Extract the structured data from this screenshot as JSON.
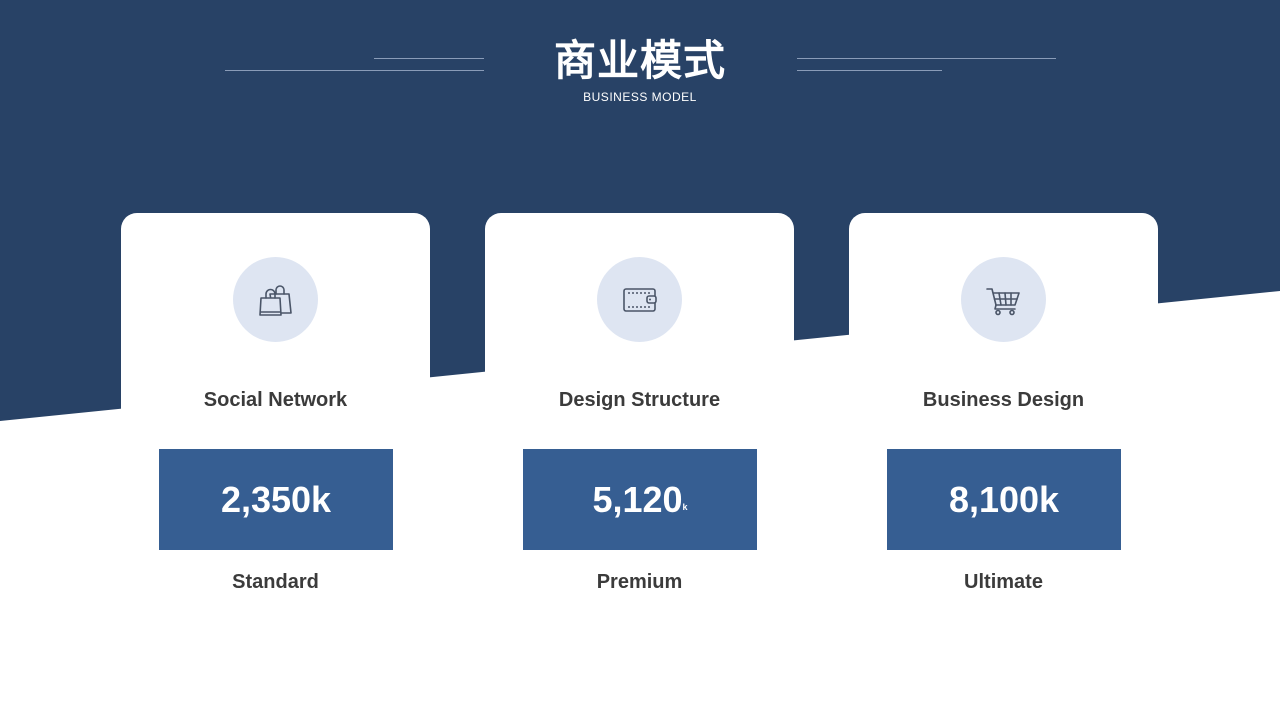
{
  "header": {
    "title": "商业模式",
    "subtitle": "BUSINESS MODEL"
  },
  "colors": {
    "navy": "#284266",
    "card_value_bg": "#365e92",
    "icon_bg": "#dee5f2",
    "text_dark": "#3b3b3b"
  },
  "cards": [
    {
      "icon": "shopping-bag-icon",
      "label": "Social Network",
      "value": "2,350k",
      "tier": "Standard"
    },
    {
      "icon": "wallet-icon",
      "label": "Design Structure",
      "value": "5,120",
      "value_suffix": "k",
      "tier": "Premium"
    },
    {
      "icon": "shopping-cart-icon",
      "label": "Business Design",
      "value": "8,100k",
      "tier": "Ultimate"
    }
  ]
}
